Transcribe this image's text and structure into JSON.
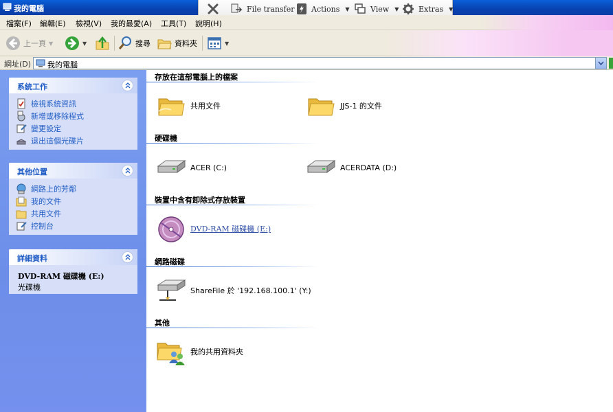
{
  "window": {
    "title": "我的電腦"
  },
  "remote_toolbar": {
    "close_label": "",
    "file_transfer": "File transfer",
    "actions": "Actions",
    "view": "View",
    "extras": "Extras"
  },
  "menu": {
    "items": [
      "檔案(F)",
      "編輯(E)",
      "檢視(V)",
      "我的最愛(A)",
      "工具(T)",
      "說明(H)"
    ]
  },
  "toolbar": {
    "back": "上一頁",
    "search": "搜尋",
    "folders": "資料夾"
  },
  "address": {
    "label": "網址(D)",
    "value": "我的電腦"
  },
  "left_pane": {
    "system_tasks": {
      "title": "系統工作",
      "items": [
        "檢視系統資訊",
        "新增或移除程式",
        "變更設定",
        "退出這個光碟片"
      ]
    },
    "other_places": {
      "title": "其他位置",
      "items": [
        "網路上的芳鄰",
        "我的文件",
        "共用文件",
        "控制台"
      ]
    },
    "details": {
      "title": "詳細資料",
      "name": "DVD-RAM 磁碟機 (E:)",
      "type": "光碟機"
    }
  },
  "content": {
    "groups": [
      {
        "title": "存放在這部電腦上的檔案",
        "items": [
          "共用文件",
          "JJS-1 的文件"
        ]
      },
      {
        "title": "硬碟機",
        "items": [
          "ACER (C:)",
          "ACERDATA (D:)"
        ]
      },
      {
        "title": "裝置中含有卸除式存放裝置",
        "items": [
          "DVD-RAM 磁碟機 (E:)"
        ]
      },
      {
        "title": "網路磁碟",
        "items": [
          "ShareFile 於 '192.168.100.1' (Y:)"
        ]
      },
      {
        "title": "其他",
        "items": [
          "我的共用資料夾"
        ]
      }
    ]
  },
  "colors": {
    "title_bar": "#0842b0",
    "task_pane": "#7b9ef0",
    "link_blue": "#215dc6",
    "selection_text": "#3150a8"
  }
}
